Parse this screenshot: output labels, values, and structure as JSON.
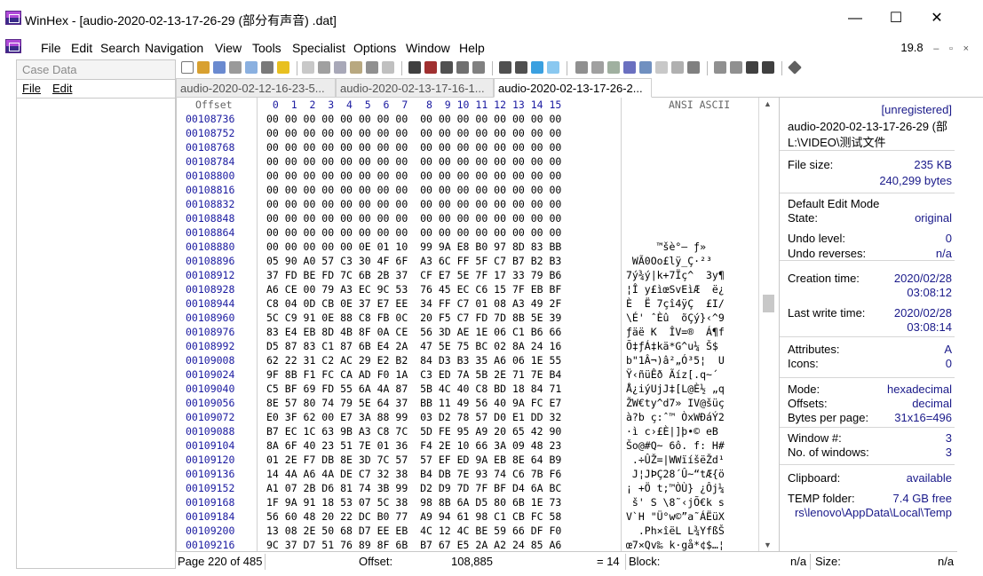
{
  "titlebar": {
    "title": "WinHex - [audio-2020-02-13-17-26-29 (部分有声音) .dat]",
    "minimize": "—",
    "maximize": "☐",
    "close": "✕"
  },
  "menubar": {
    "items": [
      "File",
      "Edit",
      "Search",
      "Navigation",
      "View",
      "Tools",
      "Specialist",
      "Options",
      "Window",
      "Help"
    ],
    "zoom": "19.8",
    "controls": [
      "–",
      "▫",
      "×"
    ]
  },
  "sidebar": {
    "header": "Case Data",
    "menu": [
      "File",
      "Edit"
    ]
  },
  "tabs": [
    {
      "label": "audio-2020-02-12-16-23-5...",
      "active": false
    },
    {
      "label": "audio-2020-02-13-17-16-1...",
      "active": false
    },
    {
      "label": "audio-2020-02-13-17-26-2...",
      "active": true
    }
  ],
  "hex": {
    "header_offset": "Offset",
    "header_cols": " 0  1  2  3  4  5  6  7   8  9 10 11 12 13 14 15",
    "header_ansi": "ANSI ASCII",
    "rows": [
      {
        "offset": "00108736",
        "hex": "00 00 00 00 00 00 00 00  00 00 00 00 00 00 00 00",
        "ascii": ""
      },
      {
        "offset": "00108752",
        "hex": "00 00 00 00 00 00 00 00  00 00 00 00 00 00 00 00",
        "ascii": ""
      },
      {
        "offset": "00108768",
        "hex": "00 00 00 00 00 00 00 00  00 00 00 00 00 00 00 00",
        "ascii": ""
      },
      {
        "offset": "00108784",
        "hex": "00 00 00 00 00 00 00 00  00 00 00 00 00 00 00 00",
        "ascii": ""
      },
      {
        "offset": "00108800",
        "hex": "00 00 00 00 00 00 00 00  00 00 00 00 00 00 00 00",
        "ascii": ""
      },
      {
        "offset": "00108816",
        "hex": "00 00 00 00 00 00 00 00  00 00 00 00 00 00 00 00",
        "ascii": ""
      },
      {
        "offset": "00108832",
        "hex": "00 00 00 00 00 00 00 00  00 00 00 00 00 00 00 00",
        "ascii": ""
      },
      {
        "offset": "00108848",
        "hex": "00 00 00 00 00 00 00 00  00 00 00 00 00 00 00 00",
        "ascii": ""
      },
      {
        "offset": "00108864",
        "hex": "00 00 00 00 00 00 00 00  00 00 00 00 00 00 00 00",
        "ascii": ""
      },
      {
        "offset": "00108880",
        "hex": "00 00 00 00 00 0E 01 10  99 9A E8 B0 97 8D 83 BB",
        "ascii": "     ™šè°— ƒ»"
      },
      {
        "offset": "00108896",
        "hex": "05 90 A0 57 C3 30 4F 6F  A3 6C FF 5F C7 B7 B2 B3",
        "ascii": " WÃ0Oo£lÿ_Ç·²³"
      },
      {
        "offset": "00108912",
        "hex": "37 FD BE FD 7C 6B 2B 37  CF E7 5E 7F 17 33 79 B6",
        "ascii": "7ý¾ý|k+7Ïç^  3y¶"
      },
      {
        "offset": "00108928",
        "hex": "A6 CE 00 79 A3 EC 9C 53  76 45 EC C6 15 7F EB BF",
        "ascii": "¦Î y£ìœSvEìÆ  ë¿"
      },
      {
        "offset": "00108944",
        "hex": "C8 04 0D CB 0E 37 E7 EE  34 FF C7 01 08 A3 49 2F",
        "ascii": "È  Ë 7çî4ÿÇ  £I/"
      },
      {
        "offset": "00108960",
        "hex": "5C C9 91 0E 88 C8 FB 0C  20 F5 C7 FD 7D 8B 5E 39",
        "ascii": "\\É' ˆÈû  õÇý}‹^9"
      },
      {
        "offset": "00108976",
        "hex": "83 E4 EB 8D 4B 8F 0A CE  56 3D AE 1E 06 C1 B6 66",
        "ascii": "ƒäë K  ÎV=®  Á¶f"
      },
      {
        "offset": "00108992",
        "hex": "D5 87 83 C1 87 6B E4 2A  47 5E 75 BC 02 8A 24 16",
        "ascii": "Õ‡ƒÁ‡kä*G^u¼ Š$ "
      },
      {
        "offset": "00109008",
        "hex": "62 22 31 C2 AC 29 E2 B2  84 D3 B3 35 A6 06 1E 55",
        "ascii": "b\"1Â¬)â²„Ó³5¦  U"
      },
      {
        "offset": "00109024",
        "hex": "9F 8B F1 FC CA AD F0 1A  C3 ED 7A 5B 2E 71 7E B4",
        "ascii": "Ÿ‹ñüÊ­ð Ãíz[.q~´"
      },
      {
        "offset": "00109040",
        "hex": "C5 BF 69 FD 55 6A 4A 87  5B 4C 40 C8 BD 18 84 71",
        "ascii": "Å¿iýUjJ‡[L@È½ „q"
      },
      {
        "offset": "00109056",
        "hex": "8E 57 80 74 79 5E 64 37  BB 11 49 56 40 9A FC E7",
        "ascii": "ŽW€ty^d7» IV@šüç"
      },
      {
        "offset": "00109072",
        "hex": "E0 3F 62 00 E7 3A 88 99  03 D2 78 57 D0 E1 DD 32",
        "ascii": "à?b ç:ˆ™ ÒxWÐáÝ2"
      },
      {
        "offset": "00109088",
        "hex": "B7 EC 1C 63 9B A3 C8 7C  5D FE 95 A9 20 65 42 90",
        "ascii": "·ì c›£È|]þ•© eB "
      },
      {
        "offset": "00109104",
        "hex": "8A 6F 40 23 51 7E 01 36  F4 2E 10 66 3A 09 48 23",
        "ascii": "Šo@#Q~ 6ô. f: H#"
      },
      {
        "offset": "00109120",
        "hex": "01 2E F7 DB 8E 3D 7C 57  57 EF ED 9A EB 8E 64 B9",
        "ascii": " .÷ÛŽ=|WWïíšëŽd¹"
      },
      {
        "offset": "00109136",
        "hex": "14 4A A6 4A DE C7 32 38  B4 DB 7E 93 74 C6 7B F6",
        "ascii": " J¦JÞÇ28´Û~“tÆ{ö"
      },
      {
        "offset": "00109152",
        "hex": "A1 07 2B D6 81 74 3B 99  D2 D9 7D 7F BF D4 6A BC",
        "ascii": "¡ +Ö t;™ÒÙ} ¿Ôj¼"
      },
      {
        "offset": "00109168",
        "hex": "1F 9A 91 18 53 07 5C 38  98 8B 6A D5 80 6B 1E 73",
        "ascii": " š' S \\8˜‹jÕ€k s"
      },
      {
        "offset": "00109184",
        "hex": "56 60 48 20 22 DC B0 77  A9 94 61 98 C1 CB FC 58",
        "ascii": "V`H \"Ü°w©”a˜ÁËüX"
      },
      {
        "offset": "00109200",
        "hex": "13 08 2E 50 68 D7 EE EB  4C 12 4C BE 59 66 DF F0",
        "ascii": "  .Ph×îëL L¾YfßŠ"
      },
      {
        "offset": "00109216",
        "hex": "9C 37 D7 51 76 89 8F 6B  B7 67 E5 2A A2 24 85 A6",
        "ascii": "œ7×Qv‰ k·gå*¢$…¦"
      }
    ]
  },
  "info": {
    "unregistered": "[unregistered]",
    "filename": "audio-2020-02-13-17-26-29 (部",
    "path": "L:\\VIDEO\\测试文件",
    "file_size_label": "File size:",
    "file_size_kb": "235 KB",
    "file_size_bytes": "240,299 bytes",
    "edit_mode": "Default Edit Mode",
    "state_label": "State:",
    "state_value": "original",
    "undo_level_label": "Undo level:",
    "undo_level_value": "0",
    "undo_reverses_label": "Undo reverses:",
    "undo_reverses_value": "n/a",
    "creation_label": "Creation time:",
    "creation_date": "2020/02/28",
    "creation_time": "03:08:12",
    "lastwrite_label": "Last write time:",
    "lastwrite_date": "2020/02/28",
    "lastwrite_time": "03:08:14",
    "attributes_label": "Attributes:",
    "attributes_value": "A",
    "icons_label": "Icons:",
    "icons_value": "0",
    "mode_label": "Mode:",
    "mode_value": "hexadecimal",
    "offsets_label": "Offsets:",
    "offsets_value": "decimal",
    "bpp_label": "Bytes per page:",
    "bpp_value": "31x16=496",
    "window_label": "Window #:",
    "window_value": "3",
    "windows_label": "No. of windows:",
    "windows_value": "3",
    "clipboard_label": "Clipboard:",
    "clipboard_value": "available",
    "temp_label": "TEMP folder:",
    "temp_value": "7.4 GB free",
    "temp_path": "rs\\lenovo\\AppData\\Local\\Temp"
  },
  "status": {
    "page": "Page 220 of 485",
    "offset_label": "Offset:",
    "offset_value": "108,885",
    "eq_value": "= 14",
    "block_label": "Block:",
    "block_value": "n/a",
    "size_label": "Size:",
    "size_value": "n/a"
  },
  "colors": {
    "offset_blue": "#1a1aa0",
    "cursor": "#2a4aa8"
  }
}
